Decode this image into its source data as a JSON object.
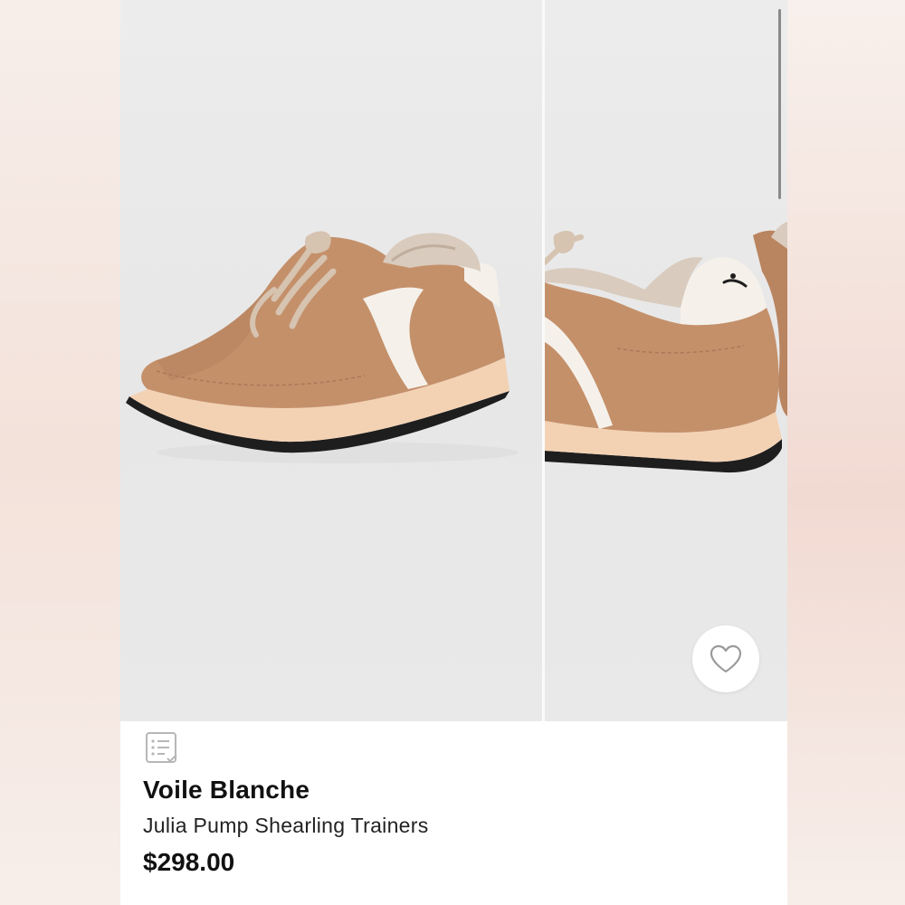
{
  "product": {
    "brand": "Voile Blanche",
    "name": "Julia Pump Shearling Trainers",
    "price": "$298.00"
  },
  "gallery": {
    "images": [
      {
        "label": "sneaker-side-view"
      },
      {
        "label": "sneaker-heel-view"
      }
    ]
  },
  "icons": {
    "favorite": "heart-outline-icon",
    "details": "list-checklist-icon"
  },
  "colors": {
    "suede": "#c4906a",
    "sole": "#f3d2b4",
    "accent_white": "#f5f1ea",
    "background": "#e9e9e9"
  }
}
